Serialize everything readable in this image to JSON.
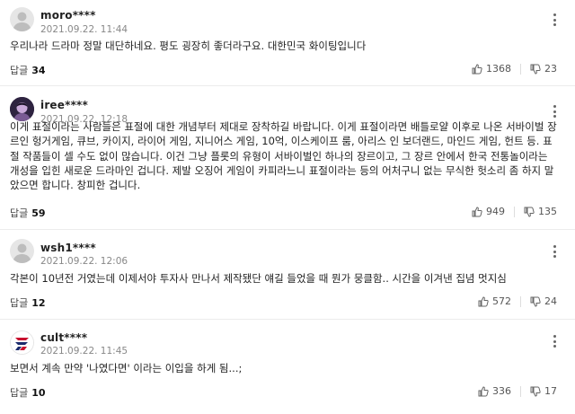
{
  "comments": [
    {
      "nickname": "moro****",
      "date": "2021.09.22. 11:44",
      "text": "우리나라 드라마 정말 대단하네요. 평도 굉장히 좋더라구요. 대한민국 화이팅입니다",
      "reply_label": "답글",
      "reply_count": "34",
      "likes": "1368",
      "dislikes": "23",
      "avatar": "default-user-icon"
    },
    {
      "nickname": "iree****",
      "date": "2021.09.22. 12:18",
      "text": "이게 표절이라는 사람들은 표절에 대한 개념부터 제대로 장착하길 바랍니다. 이게 표절이라면 배틀로얄 이후로 나온 서바이벌 장르인 헝거게임, 큐브, 카이지, 라이어 게임, 지니어스 게임, 10억, 이스케이프 룸, 아리스 인 보더랜드, 마인드 게임, 헌트 등. 표절 작품들이 셀 수도 없이 많습니다. 이건 그냥 플롯의 유형이 서바이벌인 하나의 장르이고, 그 장르 안에서 한국 전통놀이라는 개성을 입힌 새로운 드라마인 겁니다. 제발 오징어 게임이 카피라느니 표절이라는 등의 어처구니 없는 무식한 헛소리 좀 하지 말았으면 합니다. 창피한 겁니다.",
      "reply_label": "답글",
      "reply_count": "59",
      "likes": "949",
      "dislikes": "135",
      "avatar": "profile-photo"
    },
    {
      "nickname": "wsh1****",
      "date": "2021.09.22. 12:06",
      "text": "각본이 10년전 거였는데 이제서야 투자사 만나서 제작됐단 얘길 들었을 때 뭔가 뭉클함.. 시간을 이겨낸 집념 멋지심",
      "reply_label": "답글",
      "reply_count": "12",
      "likes": "572",
      "dislikes": "24",
      "avatar": "default-user-icon"
    },
    {
      "nickname": "cult****",
      "date": "2021.09.22. 11:45",
      "text": "보면서 계속 만약 '나였다면' 이라는 이입을 하게 됨...;",
      "reply_label": "답글",
      "reply_count": "10",
      "likes": "336",
      "dislikes": "17",
      "avatar": "logo-avatar"
    }
  ]
}
